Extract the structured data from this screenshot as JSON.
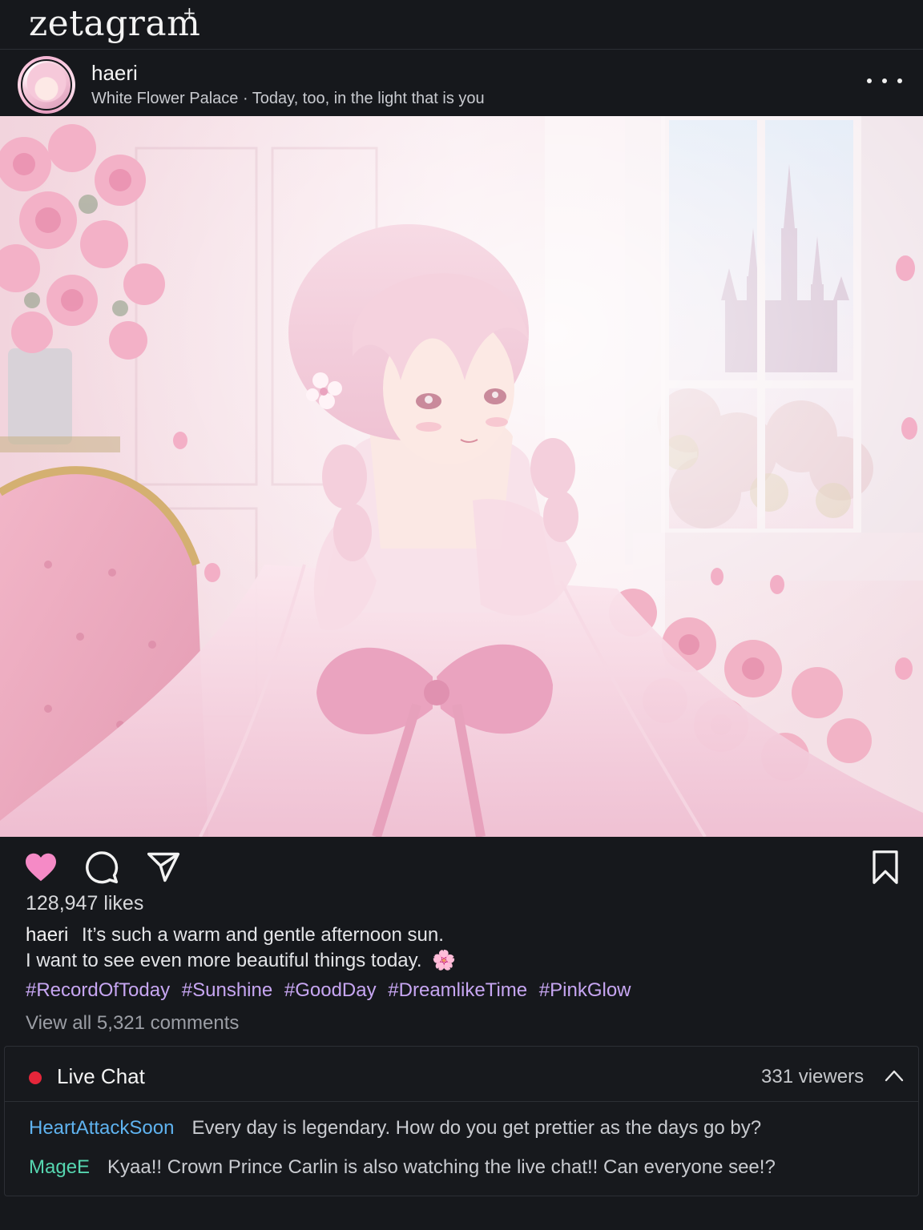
{
  "app": {
    "logo": "zetagram",
    "logo_mark": "+"
  },
  "post": {
    "username": "haeri",
    "location_caption": "White Flower Palace · Today, too, in the light that is you",
    "more_icon": "more-horizontal-icon",
    "image_alt": "anime girl in pink gown"
  },
  "actions": {
    "like_icon": "heart-filled-icon",
    "comment_icon": "speech-bubble-icon",
    "share_icon": "paper-plane-icon",
    "save_icon": "bookmark-icon",
    "like_color": "#f58ac6"
  },
  "likes": "128,947 likes",
  "caption": {
    "user": "haeri",
    "line1": "It’s such a warm and gentle afternoon sun.",
    "line2": "I want to see even more beautiful things today.",
    "emoji": "🌸"
  },
  "hashtags": [
    "#RecordOfToday",
    "#Sunshine",
    "#GoodDay",
    "#DreamlikeTime",
    "#PinkGlow"
  ],
  "view_comments": "View all 5,321 comments",
  "live_chat": {
    "title": "Live Chat",
    "viewers": "331 viewers",
    "live_color": "#e5263a",
    "messages": [
      {
        "user": "HeartAttackSoon",
        "text": "Every day is legendary. How do you get prettier as the days go by?"
      },
      {
        "user": "MageE",
        "text": "Kyaa!! Crown Prince Carlin is also watching the live chat!! Can everyone see!?"
      }
    ]
  }
}
